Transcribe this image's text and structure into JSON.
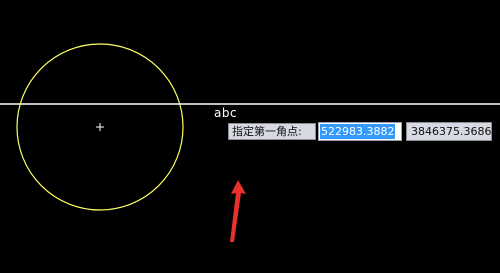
{
  "drawing": {
    "label_text": "abc",
    "circle_color": "#ffff66",
    "line_color": "#ffffff",
    "crosshair_color": "#ffffff",
    "arrow_color": "#e8302c"
  },
  "dynamic_input": {
    "prompt": "指定第一角点:",
    "x_value": "522983.3882",
    "y_value": "3846375.3686"
  }
}
